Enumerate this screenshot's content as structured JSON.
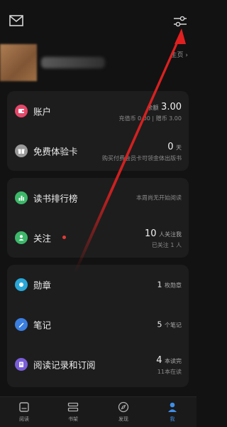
{
  "profile": {
    "homepage_label": "主页 ›"
  },
  "cards": {
    "wallet": {
      "account": {
        "title": "账户",
        "balance_label": "余额",
        "balance_value": "3.00",
        "detail": "充值币 0.00 | 赠币 3.00",
        "icon": "wallet-icon",
        "icon_color": "#e5486a"
      },
      "trial": {
        "title": "免费体验卡",
        "days_value": "0",
        "days_unit": "天",
        "detail": "购买付费会员卡可领金体出版书",
        "icon": "gift-icon",
        "icon_color": "#9a9a9a"
      }
    },
    "social": {
      "ranking": {
        "title": "读书排行榜",
        "detail": "本周尚无开始阅读",
        "icon": "ranking-icon",
        "icon_color": "#3db86a"
      },
      "follow": {
        "title": "关注",
        "count_value": "10",
        "count_text": "人关注我",
        "detail": "已关注 1 人",
        "icon": "follow-icon",
        "icon_color": "#3db86a",
        "has_new_dot": true
      }
    },
    "records": {
      "badges": {
        "title": "勋章",
        "value": "1",
        "unit": "枚勋章",
        "icon": "badge-icon",
        "icon_color": "#2aa7d8"
      },
      "notes": {
        "title": "笔记",
        "value": "5",
        "unit": "个笔记",
        "icon": "notes-icon",
        "icon_color": "#3b7fe0"
      },
      "history": {
        "title": "阅读记录和订阅",
        "value": "4",
        "unit": "本读完",
        "detail": "11本在读",
        "icon": "history-icon",
        "icon_color": "#7a5ed8"
      }
    }
  },
  "bottom_nav": {
    "items": [
      {
        "label": "阅读",
        "icon": "book-open-icon",
        "active": false
      },
      {
        "label": "书架",
        "icon": "bookshelf-icon",
        "active": false
      },
      {
        "label": "发现",
        "icon": "compass-icon",
        "active": false
      },
      {
        "label": "我",
        "icon": "person-icon",
        "active": true
      }
    ]
  },
  "colors": {
    "background": "#121212",
    "card": "#1d1d1d",
    "accent": "#3d8fe8",
    "annotation_arrow": "#e02020"
  }
}
